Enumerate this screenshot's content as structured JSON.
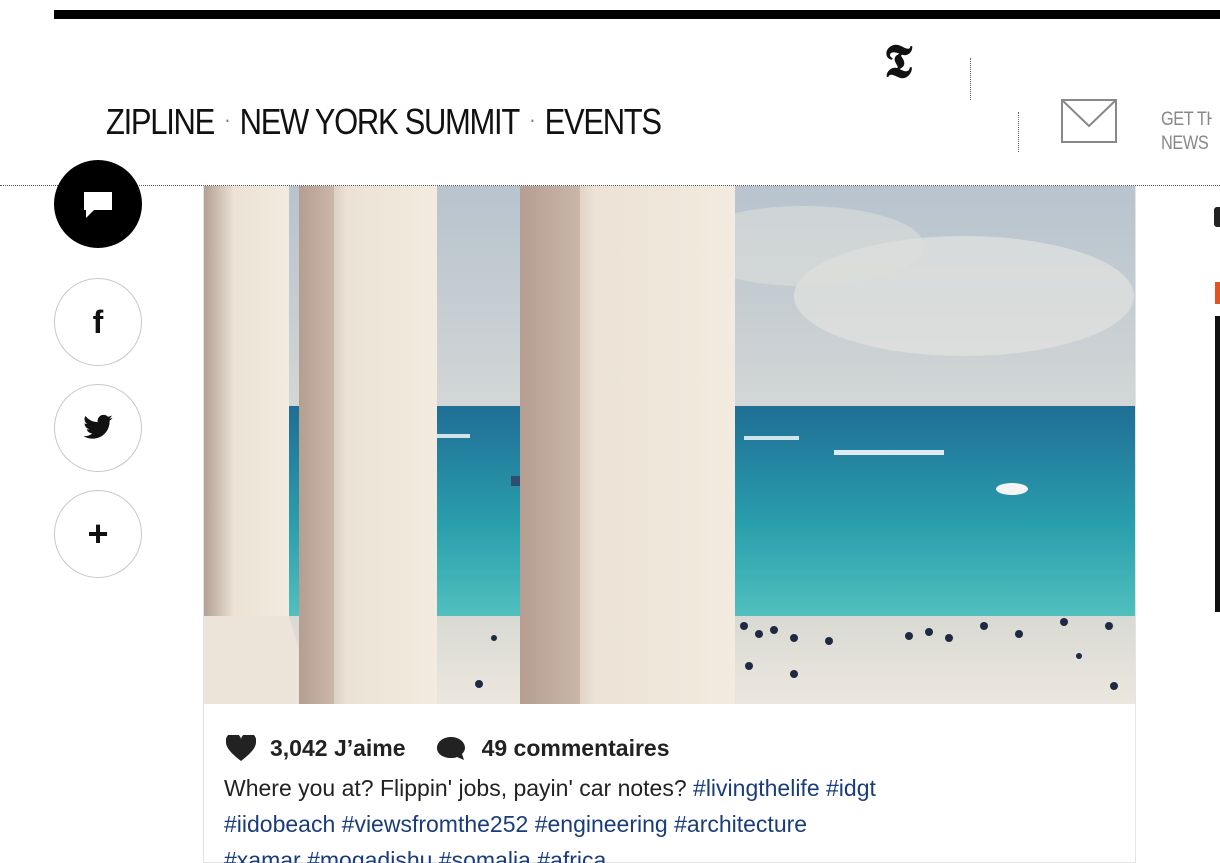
{
  "header": {
    "logo_glyph": "𝕿",
    "nav": [
      "ZIPLINE",
      "NEW YORK SUMMIT",
      "EVENTS"
    ],
    "nav_separator": "·",
    "newsletter_line1": "GET TH",
    "newsletter_line2": "NEWS"
  },
  "share_rail": {
    "comment_icon": "speech-bubble-icon",
    "facebook_glyph": "f",
    "twitter_icon": "twitter-bird-icon",
    "more_glyph": "+"
  },
  "post": {
    "likes": "3,042 J’aime",
    "comments": "49 commentaires",
    "caption_text": "Where you at? Flippin' jobs, payin' car notes?",
    "hashtags": [
      "#livingthelife",
      "#idgt",
      "#iidobeach",
      "#viewsfromthe252",
      "#engineering",
      "#architecture",
      "#xamar",
      "#mogadishu",
      "#somalia",
      "#africa"
    ]
  },
  "colors": {
    "hashtag": "#1a3d7a",
    "accent": "#e8501e"
  }
}
